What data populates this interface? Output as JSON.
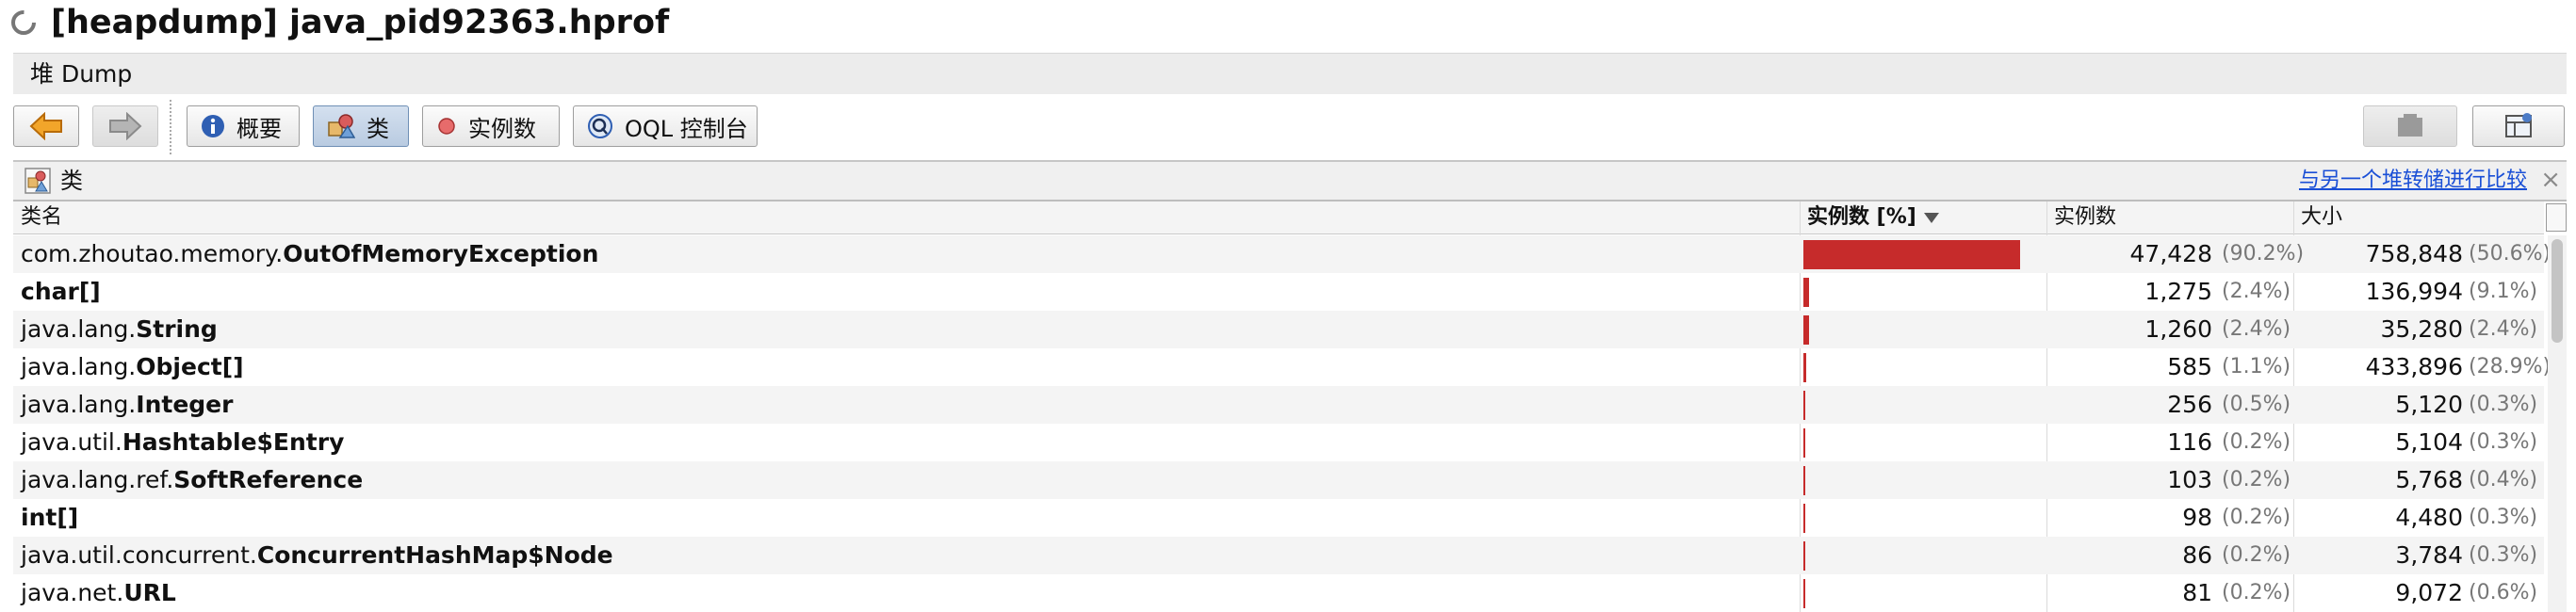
{
  "window": {
    "title": "[heapdump] java_pid92363.hprof"
  },
  "subtab": {
    "label": "堆 Dump"
  },
  "toolbar": {
    "back_icon": "back-arrow-icon",
    "forward_icon": "forward-arrow-icon",
    "buttons": [
      {
        "label": "概要",
        "icon": "info-icon"
      },
      {
        "label": "类",
        "icon": "classes-icon"
      },
      {
        "label": "实例数",
        "icon": "instance-dot-icon"
      },
      {
        "label": "OQL 控制台",
        "icon": "oql-icon"
      }
    ]
  },
  "section": {
    "label": "类",
    "compare_link": "与另一个堆转储进行比较",
    "close": "×"
  },
  "table": {
    "headers": {
      "class_name": "类名",
      "instances_pct": "实例数 [%]",
      "instances": "实例数",
      "size": "大小"
    },
    "rows": [
      {
        "pkg": "com.zhoutao.memory.",
        "cls": "OutOfMemoryException",
        "instances_fraction": 0.902,
        "instances": "47,428",
        "instances_pct": "(90.2%)",
        "size": "758,848",
        "size_pct": "(50.6%)"
      },
      {
        "pkg": "",
        "cls": "char[]",
        "instances_fraction": 0.024,
        "instances": "1,275",
        "instances_pct": "(2.4%)",
        "size": "136,994",
        "size_pct": "(9.1%)"
      },
      {
        "pkg": "java.lang.",
        "cls": "String",
        "instances_fraction": 0.024,
        "instances": "1,260",
        "instances_pct": "(2.4%)",
        "size": "35,280",
        "size_pct": "(2.4%)"
      },
      {
        "pkg": "java.lang.",
        "cls": "Object[]",
        "instances_fraction": 0.011,
        "instances": "585",
        "instances_pct": "(1.1%)",
        "size": "433,896",
        "size_pct": "(28.9%)"
      },
      {
        "pkg": "java.lang.",
        "cls": "Integer",
        "instances_fraction": 0.005,
        "instances": "256",
        "instances_pct": "(0.5%)",
        "size": "5,120",
        "size_pct": "(0.3%)"
      },
      {
        "pkg": "java.util.",
        "cls": "Hashtable$Entry",
        "instances_fraction": 0.002,
        "instances": "116",
        "instances_pct": "(0.2%)",
        "size": "5,104",
        "size_pct": "(0.3%)"
      },
      {
        "pkg": "java.lang.ref.",
        "cls": "SoftReference",
        "instances_fraction": 0.002,
        "instances": "103",
        "instances_pct": "(0.2%)",
        "size": "5,768",
        "size_pct": "(0.4%)"
      },
      {
        "pkg": "",
        "cls": "int[]",
        "instances_fraction": 0.002,
        "instances": "98",
        "instances_pct": "(0.2%)",
        "size": "4,480",
        "size_pct": "(0.3%)"
      },
      {
        "pkg": "java.util.concurrent.",
        "cls": "ConcurrentHashMap$Node",
        "instances_fraction": 0.002,
        "instances": "86",
        "instances_pct": "(0.2%)",
        "size": "3,784",
        "size_pct": "(0.3%)"
      },
      {
        "pkg": "java.net.",
        "cls": "URL",
        "instances_fraction": 0.002,
        "instances": "81",
        "instances_pct": "(0.2%)",
        "size": "9,072",
        "size_pct": "(0.6%)"
      }
    ]
  },
  "colors": {
    "bar": "#c62b2b",
    "link": "#1a4fd6",
    "percent_text": "#777777"
  }
}
